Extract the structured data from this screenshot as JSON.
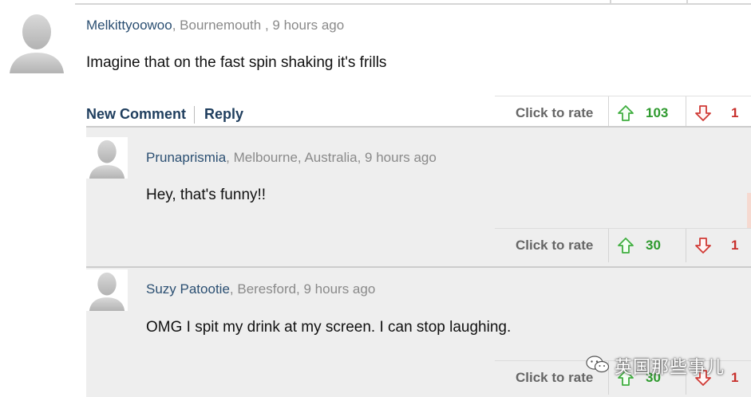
{
  "comments": [
    {
      "username": "Melkittyoowoo",
      "meta": ", Bournemouth , 9 hours ago",
      "text": "Imagine that on the fast spin shaking it's frills",
      "actions": {
        "new_comment": "New Comment",
        "reply": "Reply"
      },
      "rating": {
        "label": "Click to rate",
        "up_count": "103",
        "down_count": "1"
      }
    }
  ],
  "replies": [
    {
      "username": "Prunaprismia",
      "meta": ", Melbourne, Australia, 9 hours ago",
      "text": "Hey, that's funny!!",
      "rating": {
        "label": "Click to rate",
        "up_count": "30",
        "down_count": "1"
      }
    },
    {
      "username": "Suzy Patootie",
      "meta": ", Beresford, 9 hours ago",
      "text": "OMG I spit my drink at my screen. I can stop laughing.",
      "rating": {
        "label": "Click to rate",
        "up_count": "30",
        "down_count": "1"
      }
    }
  ],
  "watermark": {
    "text": "英国那些事儿",
    "icon": "wechat-icon"
  },
  "icons": {
    "avatar": "default-avatar-icon",
    "thumbs_up": "arrow-up-icon",
    "thumbs_down": "arrow-down-icon"
  },
  "colors": {
    "up": "#2e9a2e",
    "down": "#c8302c",
    "link": "#1f3e5e",
    "username": "#2b4f72"
  }
}
